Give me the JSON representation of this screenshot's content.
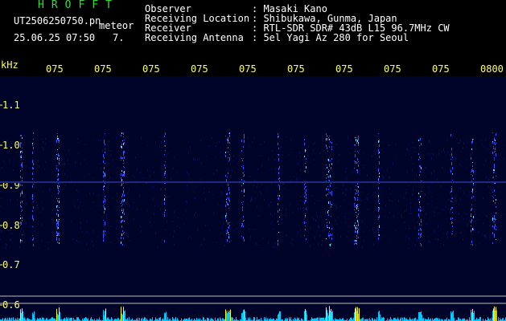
{
  "header": {
    "brand": "HROFFT",
    "filename": "UT2506250750.pn",
    "meteor_label": "meteor",
    "datetime": "25.06.25 07:50",
    "count": "7.",
    "info": [
      {
        "label": "Observer",
        "value": ": Masaki Kano"
      },
      {
        "label": "Receiving Location",
        "value": ": Shibukawa, Gunma, Japan"
      },
      {
        "label": "Receiver",
        "value": ": RTL-SDR SDR# 43dB L15 96.7MHz CW"
      },
      {
        "label": "Receiving Antenna",
        "value": ": 5el Yagi Az 280 for Seoul"
      }
    ]
  },
  "axis": {
    "unit": "kHz",
    "y_labels": [
      "1.1",
      "1.0",
      "0.9",
      "0.8",
      "0.7",
      "0.6"
    ],
    "x_labels": [
      "075",
      "075",
      "075",
      "075",
      "075",
      "075",
      "075",
      "075",
      "075",
      "0800"
    ]
  },
  "colors": {
    "background": "#000000",
    "spectrogram_bg": "#000428",
    "text_white": "#ffffff",
    "text_yellow": "#ffff66",
    "text_green": "#33dd33",
    "signal_blue": "#3355ff",
    "signal_cyan": "#66ddff",
    "level_cyan": "#00c8ff",
    "level_yellow": "#ffff00"
  }
}
